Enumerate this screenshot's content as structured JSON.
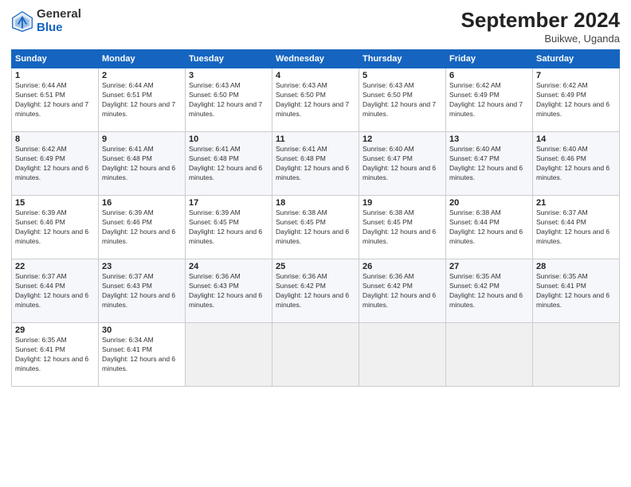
{
  "header": {
    "logo_general": "General",
    "logo_blue": "Blue",
    "month_title": "September 2024",
    "location": "Buikwe, Uganda"
  },
  "days_of_week": [
    "Sunday",
    "Monday",
    "Tuesday",
    "Wednesday",
    "Thursday",
    "Friday",
    "Saturday"
  ],
  "weeks": [
    [
      {
        "day": "1",
        "sunrise": "6:44 AM",
        "sunset": "6:51 PM",
        "daylight": "12 hours and 7 minutes."
      },
      {
        "day": "2",
        "sunrise": "6:44 AM",
        "sunset": "6:51 PM",
        "daylight": "12 hours and 7 minutes."
      },
      {
        "day": "3",
        "sunrise": "6:43 AM",
        "sunset": "6:50 PM",
        "daylight": "12 hours and 7 minutes."
      },
      {
        "day": "4",
        "sunrise": "6:43 AM",
        "sunset": "6:50 PM",
        "daylight": "12 hours and 7 minutes."
      },
      {
        "day": "5",
        "sunrise": "6:43 AM",
        "sunset": "6:50 PM",
        "daylight": "12 hours and 7 minutes."
      },
      {
        "day": "6",
        "sunrise": "6:42 AM",
        "sunset": "6:49 PM",
        "daylight": "12 hours and 7 minutes."
      },
      {
        "day": "7",
        "sunrise": "6:42 AM",
        "sunset": "6:49 PM",
        "daylight": "12 hours and 6 minutes."
      }
    ],
    [
      {
        "day": "8",
        "sunrise": "6:42 AM",
        "sunset": "6:49 PM",
        "daylight": "12 hours and 6 minutes."
      },
      {
        "day": "9",
        "sunrise": "6:41 AM",
        "sunset": "6:48 PM",
        "daylight": "12 hours and 6 minutes."
      },
      {
        "day": "10",
        "sunrise": "6:41 AM",
        "sunset": "6:48 PM",
        "daylight": "12 hours and 6 minutes."
      },
      {
        "day": "11",
        "sunrise": "6:41 AM",
        "sunset": "6:48 PM",
        "daylight": "12 hours and 6 minutes."
      },
      {
        "day": "12",
        "sunrise": "6:40 AM",
        "sunset": "6:47 PM",
        "daylight": "12 hours and 6 minutes."
      },
      {
        "day": "13",
        "sunrise": "6:40 AM",
        "sunset": "6:47 PM",
        "daylight": "12 hours and 6 minutes."
      },
      {
        "day": "14",
        "sunrise": "6:40 AM",
        "sunset": "6:46 PM",
        "daylight": "12 hours and 6 minutes."
      }
    ],
    [
      {
        "day": "15",
        "sunrise": "6:39 AM",
        "sunset": "6:46 PM",
        "daylight": "12 hours and 6 minutes."
      },
      {
        "day": "16",
        "sunrise": "6:39 AM",
        "sunset": "6:46 PM",
        "daylight": "12 hours and 6 minutes."
      },
      {
        "day": "17",
        "sunrise": "6:39 AM",
        "sunset": "6:45 PM",
        "daylight": "12 hours and 6 minutes."
      },
      {
        "day": "18",
        "sunrise": "6:38 AM",
        "sunset": "6:45 PM",
        "daylight": "12 hours and 6 minutes."
      },
      {
        "day": "19",
        "sunrise": "6:38 AM",
        "sunset": "6:45 PM",
        "daylight": "12 hours and 6 minutes."
      },
      {
        "day": "20",
        "sunrise": "6:38 AM",
        "sunset": "6:44 PM",
        "daylight": "12 hours and 6 minutes."
      },
      {
        "day": "21",
        "sunrise": "6:37 AM",
        "sunset": "6:44 PM",
        "daylight": "12 hours and 6 minutes."
      }
    ],
    [
      {
        "day": "22",
        "sunrise": "6:37 AM",
        "sunset": "6:44 PM",
        "daylight": "12 hours and 6 minutes."
      },
      {
        "day": "23",
        "sunrise": "6:37 AM",
        "sunset": "6:43 PM",
        "daylight": "12 hours and 6 minutes."
      },
      {
        "day": "24",
        "sunrise": "6:36 AM",
        "sunset": "6:43 PM",
        "daylight": "12 hours and 6 minutes."
      },
      {
        "day": "25",
        "sunrise": "6:36 AM",
        "sunset": "6:42 PM",
        "daylight": "12 hours and 6 minutes."
      },
      {
        "day": "26",
        "sunrise": "6:36 AM",
        "sunset": "6:42 PM",
        "daylight": "12 hours and 6 minutes."
      },
      {
        "day": "27",
        "sunrise": "6:35 AM",
        "sunset": "6:42 PM",
        "daylight": "12 hours and 6 minutes."
      },
      {
        "day": "28",
        "sunrise": "6:35 AM",
        "sunset": "6:41 PM",
        "daylight": "12 hours and 6 minutes."
      }
    ],
    [
      {
        "day": "29",
        "sunrise": "6:35 AM",
        "sunset": "6:41 PM",
        "daylight": "12 hours and 6 minutes."
      },
      {
        "day": "30",
        "sunrise": "6:34 AM",
        "sunset": "6:41 PM",
        "daylight": "12 hours and 6 minutes."
      },
      null,
      null,
      null,
      null,
      null
    ]
  ]
}
